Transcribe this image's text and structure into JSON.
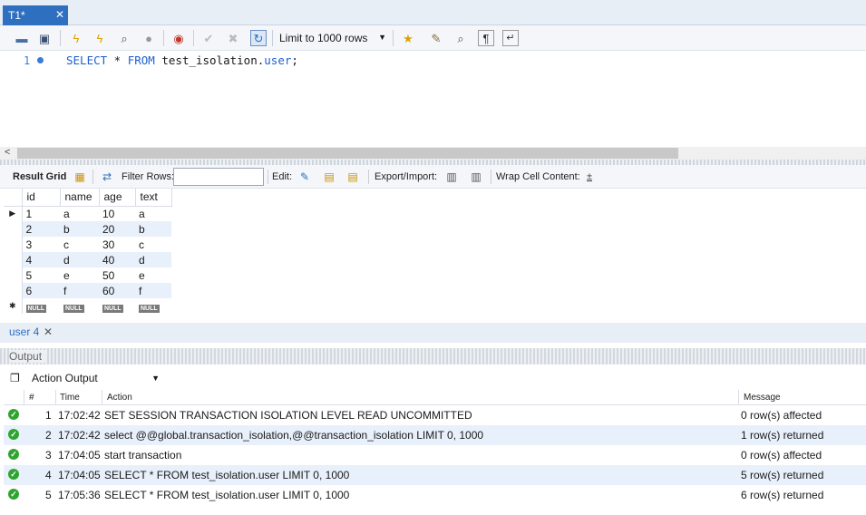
{
  "tab": {
    "title": "T1*",
    "close": "✕"
  },
  "toolbar": {
    "limit_select": "Limit to 1000 rows"
  },
  "editor": {
    "line_number": "1",
    "code": {
      "select": "SELECT",
      "star": " * ",
      "from": "FROM",
      "table_schema": " test_isolation.",
      "table_name": "user",
      "semicolon": ";"
    }
  },
  "result_bar": {
    "result_grid": "Result Grid",
    "filter_rows": "Filter Rows:",
    "filter_value": "",
    "edit": "Edit:",
    "export_import": "Export/Import:",
    "wrap_cell": "Wrap Cell Content:"
  },
  "grid": {
    "columns": [
      "id",
      "name",
      "age",
      "text"
    ],
    "rows": [
      [
        "1",
        "a",
        "10",
        "a"
      ],
      [
        "2",
        "b",
        "20",
        "b"
      ],
      [
        "3",
        "c",
        "30",
        "c"
      ],
      [
        "4",
        "d",
        "40",
        "d"
      ],
      [
        "5",
        "e",
        "50",
        "e"
      ],
      [
        "6",
        "f",
        "60",
        "f"
      ]
    ],
    "null_label": "NULL",
    "current_marker": "▶",
    "new_marker": "✱"
  },
  "result_tabs": {
    "active": "user 4",
    "close": "✕"
  },
  "output": {
    "title": "Output",
    "select": "Action Output",
    "columns": {
      "num": "#",
      "time": "Time",
      "action": "Action",
      "message": "Message"
    },
    "rows": [
      {
        "num": "1",
        "time": "17:02:42",
        "action": "SET SESSION TRANSACTION ISOLATION LEVEL READ UNCOMMITTED",
        "message": "0 row(s) affected"
      },
      {
        "num": "2",
        "time": "17:02:42",
        "action": "select @@global.transaction_isolation,@@transaction_isolation LIMIT 0, 1000",
        "message": "1 row(s) returned"
      },
      {
        "num": "3",
        "time": "17:04:05",
        "action": "start transaction",
        "message": "0 row(s) affected"
      },
      {
        "num": "4",
        "time": "17:04:05",
        "action": "SELECT * FROM test_isolation.user LIMIT 0, 1000",
        "message": "5 row(s) returned"
      },
      {
        "num": "5",
        "time": "17:05:36",
        "action": "SELECT * FROM test_isolation.user LIMIT 0, 1000",
        "message": "6 row(s) returned"
      }
    ]
  }
}
